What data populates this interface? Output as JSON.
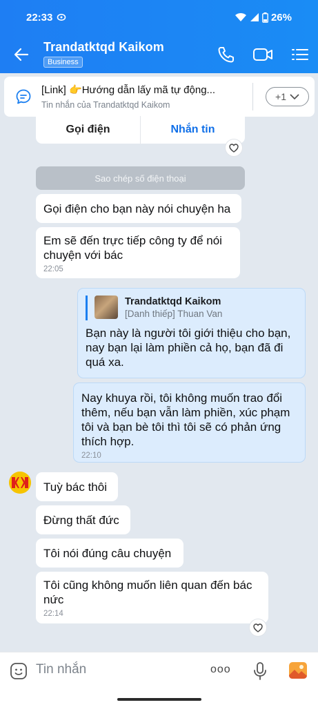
{
  "status": {
    "time": "22:33",
    "battery": "26%"
  },
  "header": {
    "name": "Trandatktqd Kaikom",
    "badge": "Business"
  },
  "pinned": {
    "title": "[Link] 👉Hướng dẫn lấy mã tự động...",
    "subtitle": "Tin nhắn của Trandatktqd Kaikom",
    "more": "+1"
  },
  "card": {
    "call": "Gọi điện",
    "message": "Nhắn tin",
    "copy": "Sao chép số điện thoại"
  },
  "messages": {
    "m1": "Gọi điện cho bạn này nói chuyện ha",
    "m2": "Em sẽ đến trực tiếp công ty để nói chuyện với bác",
    "m2_time": "22:05",
    "quote_name": "Trandatktqd Kaikom",
    "quote_sub": "[Danh thiếp] Thuan Van",
    "m3": "Bạn này là người tôi giới thiệu cho bạn, nay bạn lại làm phiền cả họ, bạn đã đi quá xa.",
    "m4": "Nay khuya rồi, tôi không muốn trao đổi thêm, nếu bạn vẫn làm phiền, xúc phạm tôi và bạn bè tôi thì tôi sẽ có phản ứng thích hợp.",
    "m4_time": "22:10",
    "m5": "Tuỳ bác thôi",
    "m6": "Đừng thất đức",
    "m7": "Tôi nói đúng câu chuyện",
    "m8": "Tôi cũng không muốn liên quan đến bác nức",
    "m8_time": "22:14"
  },
  "composer": {
    "placeholder": "Tin nhắn",
    "more": "ooo"
  },
  "colors": {
    "header": "#1e7ef3",
    "mine": "#dcecfd",
    "link": "#0f6fe8"
  },
  "icons": [
    "wifi-icon",
    "signal-icon",
    "battery-icon",
    "back-arrow-icon",
    "phone-icon",
    "video-icon",
    "menu-icon",
    "chat-bubble-icon",
    "heart-icon",
    "emoji-icon",
    "mic-icon",
    "image-icon"
  ]
}
